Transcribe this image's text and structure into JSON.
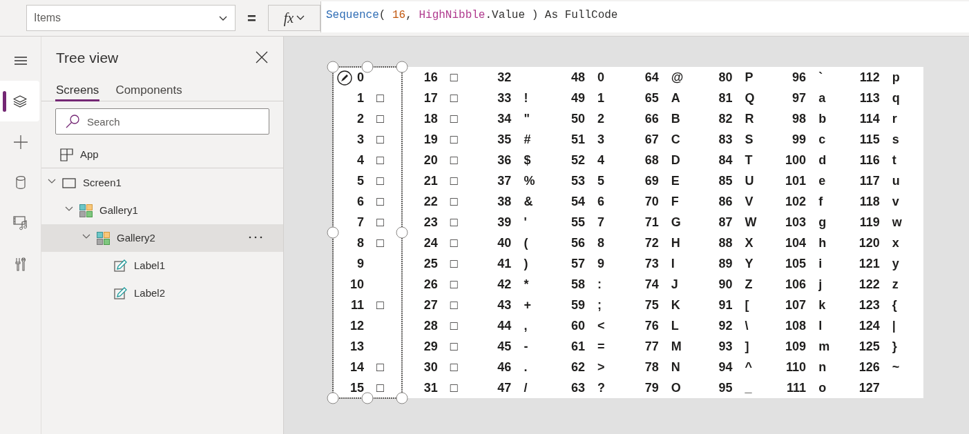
{
  "property_dropdown": {
    "value": "Items"
  },
  "equals": "=",
  "fx_button": {
    "label": "fx"
  },
  "formula": [
    {
      "kind": "function",
      "text": "Sequence"
    },
    {
      "kind": "plain",
      "text": "( "
    },
    {
      "kind": "number",
      "text": "16"
    },
    {
      "kind": "plain",
      "text": ", "
    },
    {
      "kind": "variable",
      "text": "HighNibble"
    },
    {
      "kind": "plain",
      "text": ".Value ) As FullCode"
    }
  ],
  "rail": [
    {
      "kind": "menu",
      "selected": false
    },
    {
      "kind": "layers",
      "selected": true
    },
    {
      "kind": "insert",
      "selected": false
    },
    {
      "kind": "data",
      "selected": false
    },
    {
      "kind": "media",
      "selected": false
    },
    {
      "kind": "tools",
      "selected": false
    }
  ],
  "tree_view": {
    "title": "Tree view",
    "tabs": [
      {
        "label": "Screens",
        "selected": true
      },
      {
        "label": "Components",
        "selected": false
      }
    ],
    "search": {
      "placeholder": "Search"
    },
    "app": {
      "label": "App"
    },
    "items": [
      {
        "label": "Screen1",
        "kind": "screen",
        "expanded": true,
        "selected": false,
        "children": [
          {
            "label": "Gallery1",
            "kind": "gallery",
            "expanded": true,
            "selected": false,
            "children": [
              {
                "label": "Gallery2",
                "kind": "gallery",
                "expanded": true,
                "selected": true,
                "children": [
                  {
                    "label": "Label1",
                    "kind": "label",
                    "selected": false
                  },
                  {
                    "label": "Label2",
                    "kind": "label",
                    "selected": false
                  }
                ]
              }
            ]
          }
        ]
      }
    ]
  },
  "gallery": {
    "columns": [
      {
        "selected": true,
        "cells": [
          {
            "code": "0"
          },
          {
            "code": "1",
            "char": "□"
          },
          {
            "code": "2",
            "char": "□"
          },
          {
            "code": "3",
            "char": "□"
          },
          {
            "code": "4",
            "char": "□"
          },
          {
            "code": "5",
            "char": "□"
          },
          {
            "code": "6",
            "char": "□"
          },
          {
            "code": "7",
            "char": "□"
          },
          {
            "code": "8",
            "char": "□"
          },
          {
            "code": "9"
          },
          {
            "code": "10"
          },
          {
            "code": "11",
            "char": "□"
          },
          {
            "code": "12"
          },
          {
            "code": "13"
          },
          {
            "code": "14",
            "char": "□"
          },
          {
            "code": "15",
            "char": "□"
          }
        ]
      },
      {
        "selected": false,
        "cells": [
          {
            "code": "16",
            "char": "□"
          },
          {
            "code": "17",
            "char": "□"
          },
          {
            "code": "18",
            "char": "□"
          },
          {
            "code": "19",
            "char": "□"
          },
          {
            "code": "20",
            "char": "□"
          },
          {
            "code": "21",
            "char": "□"
          },
          {
            "code": "22",
            "char": "□"
          },
          {
            "code": "23",
            "char": "□"
          },
          {
            "code": "24",
            "char": "□"
          },
          {
            "code": "25",
            "char": "□"
          },
          {
            "code": "26",
            "char": "□"
          },
          {
            "code": "27",
            "char": "□"
          },
          {
            "code": "28",
            "char": "□"
          },
          {
            "code": "29",
            "char": "□"
          },
          {
            "code": "30",
            "char": "□"
          },
          {
            "code": "31",
            "char": "□"
          }
        ]
      },
      {
        "selected": false,
        "cells": [
          {
            "code": "32"
          },
          {
            "code": "33",
            "char": "!"
          },
          {
            "code": "34",
            "char": "\""
          },
          {
            "code": "35",
            "char": "#"
          },
          {
            "code": "36",
            "char": "$"
          },
          {
            "code": "37",
            "char": "%"
          },
          {
            "code": "38",
            "char": "&"
          },
          {
            "code": "39",
            "char": "'"
          },
          {
            "code": "40",
            "char": "("
          },
          {
            "code": "41",
            "char": ")"
          },
          {
            "code": "42",
            "char": "*"
          },
          {
            "code": "43",
            "char": "+"
          },
          {
            "code": "44",
            "char": ","
          },
          {
            "code": "45",
            "char": "-"
          },
          {
            "code": "46",
            "char": "."
          },
          {
            "code": "47",
            "char": "/"
          }
        ]
      },
      {
        "selected": false,
        "cells": [
          {
            "code": "48",
            "char": "0"
          },
          {
            "code": "49",
            "char": "1"
          },
          {
            "code": "50",
            "char": "2"
          },
          {
            "code": "51",
            "char": "3"
          },
          {
            "code": "52",
            "char": "4"
          },
          {
            "code": "53",
            "char": "5"
          },
          {
            "code": "54",
            "char": "6"
          },
          {
            "code": "55",
            "char": "7"
          },
          {
            "code": "56",
            "char": "8"
          },
          {
            "code": "57",
            "char": "9"
          },
          {
            "code": "58",
            "char": ":"
          },
          {
            "code": "59",
            "char": ";"
          },
          {
            "code": "60",
            "char": "<"
          },
          {
            "code": "61",
            "char": "="
          },
          {
            "code": "62",
            "char": ">"
          },
          {
            "code": "63",
            "char": "?"
          }
        ]
      },
      {
        "selected": false,
        "cells": [
          {
            "code": "64",
            "char": "@"
          },
          {
            "code": "65",
            "char": "A"
          },
          {
            "code": "66",
            "char": "B"
          },
          {
            "code": "67",
            "char": "C"
          },
          {
            "code": "68",
            "char": "D"
          },
          {
            "code": "69",
            "char": "E"
          },
          {
            "code": "70",
            "char": "F"
          },
          {
            "code": "71",
            "char": "G"
          },
          {
            "code": "72",
            "char": "H"
          },
          {
            "code": "73",
            "char": "I"
          },
          {
            "code": "74",
            "char": "J"
          },
          {
            "code": "75",
            "char": "K"
          },
          {
            "code": "76",
            "char": "L"
          },
          {
            "code": "77",
            "char": "M"
          },
          {
            "code": "78",
            "char": "N"
          },
          {
            "code": "79",
            "char": "O"
          }
        ]
      },
      {
        "selected": false,
        "cells": [
          {
            "code": "80",
            "char": "P"
          },
          {
            "code": "81",
            "char": "Q"
          },
          {
            "code": "82",
            "char": "R"
          },
          {
            "code": "83",
            "char": "S"
          },
          {
            "code": "84",
            "char": "T"
          },
          {
            "code": "85",
            "char": "U"
          },
          {
            "code": "86",
            "char": "V"
          },
          {
            "code": "87",
            "char": "W"
          },
          {
            "code": "88",
            "char": "X"
          },
          {
            "code": "89",
            "char": "Y"
          },
          {
            "code": "90",
            "char": "Z"
          },
          {
            "code": "91",
            "char": "["
          },
          {
            "code": "92",
            "char": "\\"
          },
          {
            "code": "93",
            "char": "]"
          },
          {
            "code": "94",
            "char": "^"
          },
          {
            "code": "95",
            "char": "_"
          }
        ]
      },
      {
        "selected": false,
        "cells": [
          {
            "code": "96",
            "char": "`"
          },
          {
            "code": "97",
            "char": "a"
          },
          {
            "code": "98",
            "char": "b"
          },
          {
            "code": "99",
            "char": "c"
          },
          {
            "code": "100",
            "char": "d"
          },
          {
            "code": "101",
            "char": "e"
          },
          {
            "code": "102",
            "char": "f"
          },
          {
            "code": "103",
            "char": "g"
          },
          {
            "code": "104",
            "char": "h"
          },
          {
            "code": "105",
            "char": "i"
          },
          {
            "code": "106",
            "char": "j"
          },
          {
            "code": "107",
            "char": "k"
          },
          {
            "code": "108",
            "char": "l"
          },
          {
            "code": "109",
            "char": "m"
          },
          {
            "code": "110",
            "char": "n"
          },
          {
            "code": "111",
            "char": "o"
          }
        ]
      },
      {
        "selected": false,
        "cells": [
          {
            "code": "112",
            "char": "p"
          },
          {
            "code": "113",
            "char": "q"
          },
          {
            "code": "114",
            "char": "r"
          },
          {
            "code": "115",
            "char": "s"
          },
          {
            "code": "116",
            "char": "t"
          },
          {
            "code": "117",
            "char": "u"
          },
          {
            "code": "118",
            "char": "v"
          },
          {
            "code": "119",
            "char": "w"
          },
          {
            "code": "120",
            "char": "x"
          },
          {
            "code": "121",
            "char": "y"
          },
          {
            "code": "122",
            "char": "z"
          },
          {
            "code": "123",
            "char": "{"
          },
          {
            "code": "124",
            "char": "|"
          },
          {
            "code": "125",
            "char": "}"
          },
          {
            "code": "126",
            "char": "~"
          },
          {
            "code": "127"
          }
        ]
      }
    ]
  }
}
